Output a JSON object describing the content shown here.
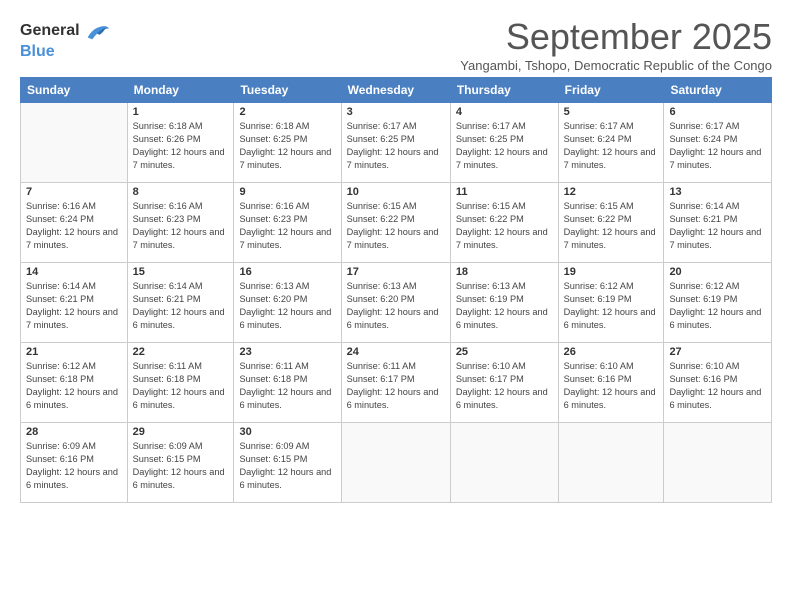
{
  "logo": {
    "line1": "General",
    "line2": "Blue"
  },
  "title": "September 2025",
  "subtitle": "Yangambi, Tshopo, Democratic Republic of the Congo",
  "days_header": [
    "Sunday",
    "Monday",
    "Tuesday",
    "Wednesday",
    "Thursday",
    "Friday",
    "Saturday"
  ],
  "weeks": [
    [
      {
        "day": "",
        "info": ""
      },
      {
        "day": "1",
        "info": "Sunrise: 6:18 AM\nSunset: 6:26 PM\nDaylight: 12 hours\nand 7 minutes."
      },
      {
        "day": "2",
        "info": "Sunrise: 6:18 AM\nSunset: 6:25 PM\nDaylight: 12 hours\nand 7 minutes."
      },
      {
        "day": "3",
        "info": "Sunrise: 6:17 AM\nSunset: 6:25 PM\nDaylight: 12 hours\nand 7 minutes."
      },
      {
        "day": "4",
        "info": "Sunrise: 6:17 AM\nSunset: 6:25 PM\nDaylight: 12 hours\nand 7 minutes."
      },
      {
        "day": "5",
        "info": "Sunrise: 6:17 AM\nSunset: 6:24 PM\nDaylight: 12 hours\nand 7 minutes."
      },
      {
        "day": "6",
        "info": "Sunrise: 6:17 AM\nSunset: 6:24 PM\nDaylight: 12 hours\nand 7 minutes."
      }
    ],
    [
      {
        "day": "7",
        "info": "Sunrise: 6:16 AM\nSunset: 6:24 PM\nDaylight: 12 hours\nand 7 minutes."
      },
      {
        "day": "8",
        "info": "Sunrise: 6:16 AM\nSunset: 6:23 PM\nDaylight: 12 hours\nand 7 minutes."
      },
      {
        "day": "9",
        "info": "Sunrise: 6:16 AM\nSunset: 6:23 PM\nDaylight: 12 hours\nand 7 minutes."
      },
      {
        "day": "10",
        "info": "Sunrise: 6:15 AM\nSunset: 6:22 PM\nDaylight: 12 hours\nand 7 minutes."
      },
      {
        "day": "11",
        "info": "Sunrise: 6:15 AM\nSunset: 6:22 PM\nDaylight: 12 hours\nand 7 minutes."
      },
      {
        "day": "12",
        "info": "Sunrise: 6:15 AM\nSunset: 6:22 PM\nDaylight: 12 hours\nand 7 minutes."
      },
      {
        "day": "13",
        "info": "Sunrise: 6:14 AM\nSunset: 6:21 PM\nDaylight: 12 hours\nand 7 minutes."
      }
    ],
    [
      {
        "day": "14",
        "info": "Sunrise: 6:14 AM\nSunset: 6:21 PM\nDaylight: 12 hours\nand 7 minutes."
      },
      {
        "day": "15",
        "info": "Sunrise: 6:14 AM\nSunset: 6:21 PM\nDaylight: 12 hours\nand 6 minutes."
      },
      {
        "day": "16",
        "info": "Sunrise: 6:13 AM\nSunset: 6:20 PM\nDaylight: 12 hours\nand 6 minutes."
      },
      {
        "day": "17",
        "info": "Sunrise: 6:13 AM\nSunset: 6:20 PM\nDaylight: 12 hours\nand 6 minutes."
      },
      {
        "day": "18",
        "info": "Sunrise: 6:13 AM\nSunset: 6:19 PM\nDaylight: 12 hours\nand 6 minutes."
      },
      {
        "day": "19",
        "info": "Sunrise: 6:12 AM\nSunset: 6:19 PM\nDaylight: 12 hours\nand 6 minutes."
      },
      {
        "day": "20",
        "info": "Sunrise: 6:12 AM\nSunset: 6:19 PM\nDaylight: 12 hours\nand 6 minutes."
      }
    ],
    [
      {
        "day": "21",
        "info": "Sunrise: 6:12 AM\nSunset: 6:18 PM\nDaylight: 12 hours\nand 6 minutes."
      },
      {
        "day": "22",
        "info": "Sunrise: 6:11 AM\nSunset: 6:18 PM\nDaylight: 12 hours\nand 6 minutes."
      },
      {
        "day": "23",
        "info": "Sunrise: 6:11 AM\nSunset: 6:18 PM\nDaylight: 12 hours\nand 6 minutes."
      },
      {
        "day": "24",
        "info": "Sunrise: 6:11 AM\nSunset: 6:17 PM\nDaylight: 12 hours\nand 6 minutes."
      },
      {
        "day": "25",
        "info": "Sunrise: 6:10 AM\nSunset: 6:17 PM\nDaylight: 12 hours\nand 6 minutes."
      },
      {
        "day": "26",
        "info": "Sunrise: 6:10 AM\nSunset: 6:16 PM\nDaylight: 12 hours\nand 6 minutes."
      },
      {
        "day": "27",
        "info": "Sunrise: 6:10 AM\nSunset: 6:16 PM\nDaylight: 12 hours\nand 6 minutes."
      }
    ],
    [
      {
        "day": "28",
        "info": "Sunrise: 6:09 AM\nSunset: 6:16 PM\nDaylight: 12 hours\nand 6 minutes."
      },
      {
        "day": "29",
        "info": "Sunrise: 6:09 AM\nSunset: 6:15 PM\nDaylight: 12 hours\nand 6 minutes."
      },
      {
        "day": "30",
        "info": "Sunrise: 6:09 AM\nSunset: 6:15 PM\nDaylight: 12 hours\nand 6 minutes."
      },
      {
        "day": "",
        "info": ""
      },
      {
        "day": "",
        "info": ""
      },
      {
        "day": "",
        "info": ""
      },
      {
        "day": "",
        "info": ""
      }
    ]
  ]
}
